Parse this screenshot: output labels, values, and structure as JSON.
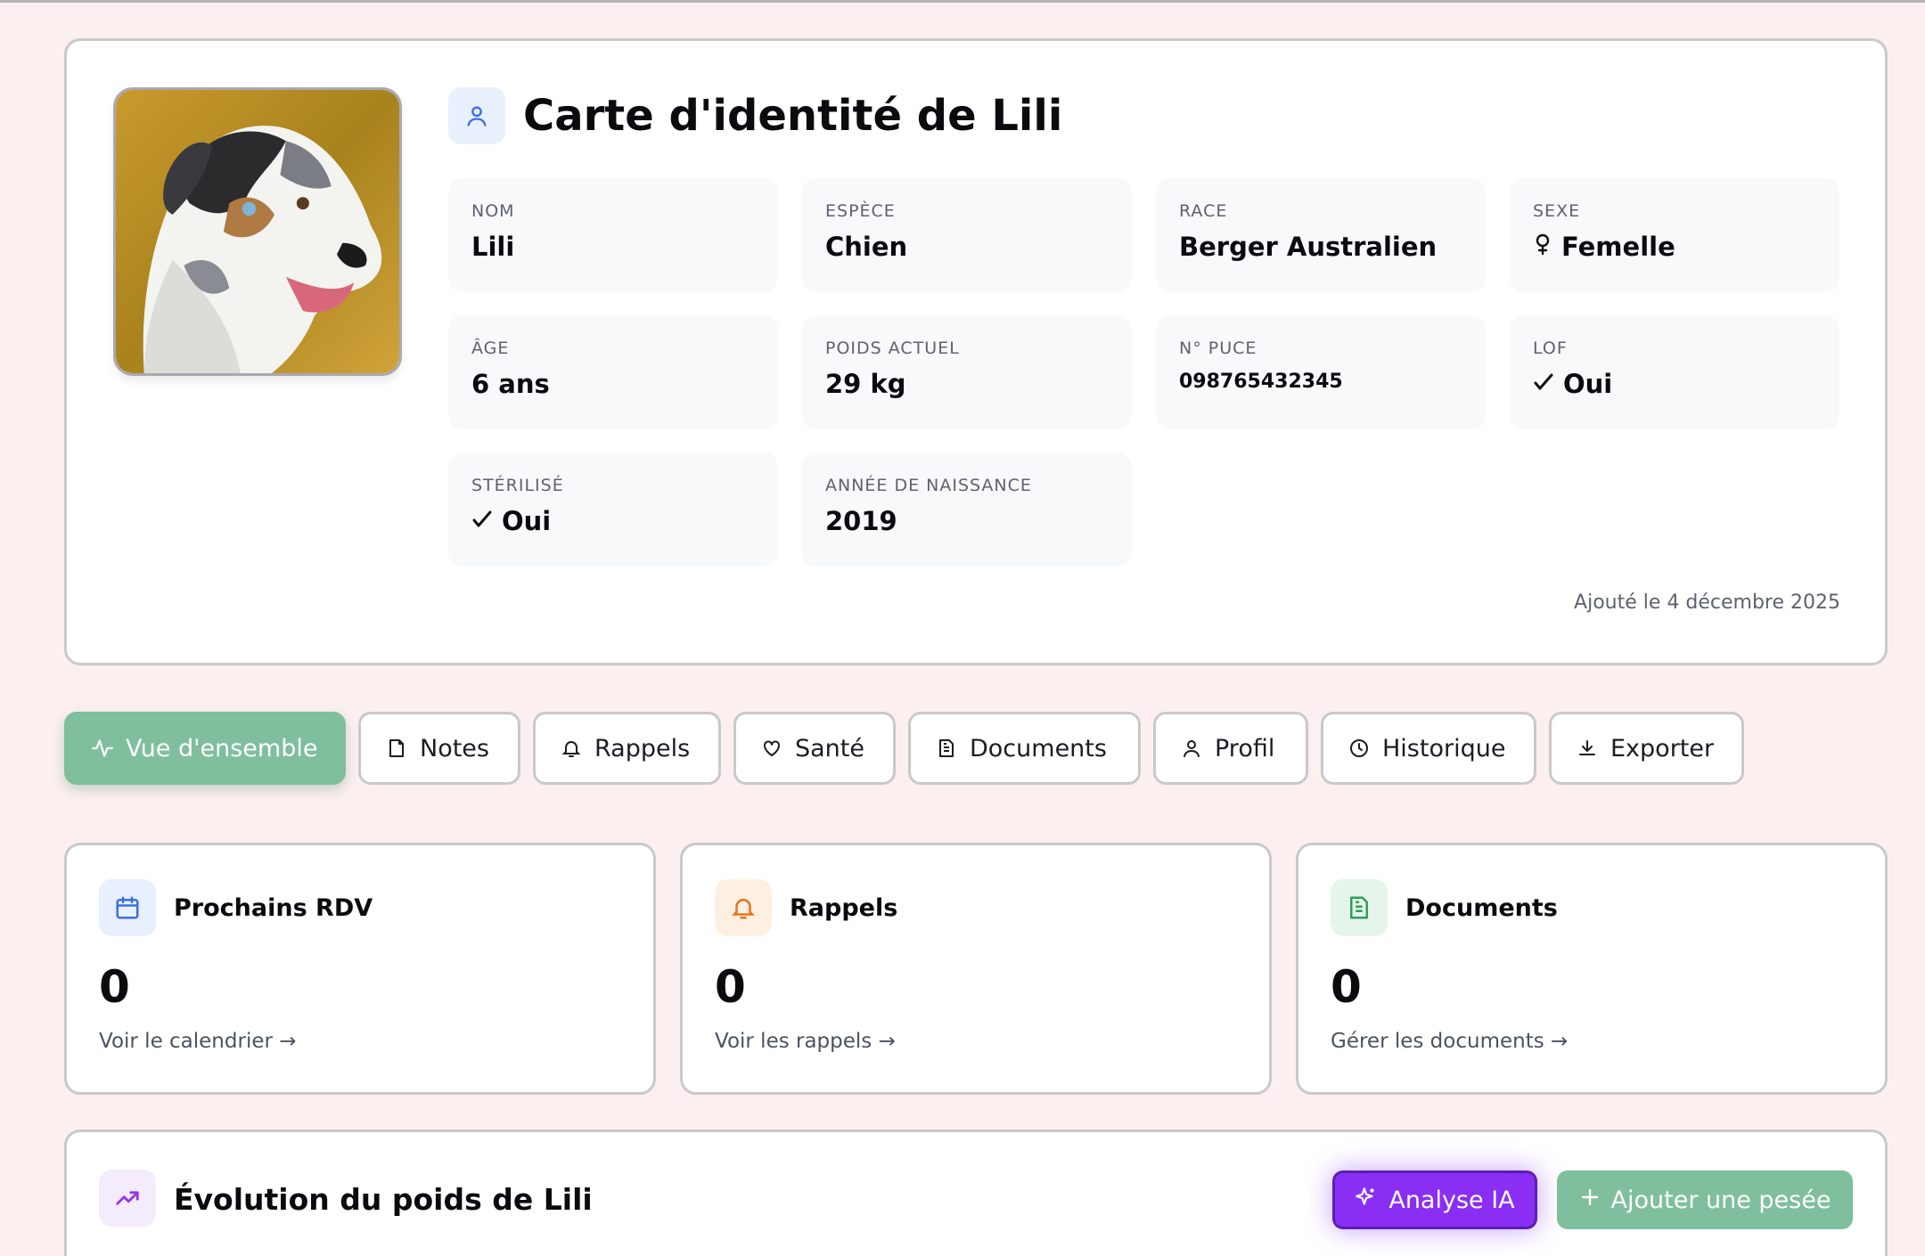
{
  "identity": {
    "title": "Carte d'identité de Lili",
    "fields": [
      {
        "label": "NOM",
        "value": "Lili"
      },
      {
        "label": "ESPÈCE",
        "value": "Chien"
      },
      {
        "label": "RACE",
        "value": "Berger Australien"
      },
      {
        "label": "SEXE",
        "value": "Femelle"
      },
      {
        "label": "ÂGE",
        "value": "6 ans"
      },
      {
        "label": "POIDS ACTUEL",
        "value": "29 kg"
      },
      {
        "label": "N° PUCE",
        "value": "098765432345"
      },
      {
        "label": "LOF",
        "value": "Oui"
      },
      {
        "label": "STÉRILISÉ",
        "value": "Oui"
      },
      {
        "label": "ANNÉE DE NAISSANCE",
        "value": "2019"
      }
    ],
    "added": "Ajouté le 4 décembre 2025"
  },
  "tabs": [
    {
      "label": "Vue d'ensemble",
      "icon": "activity-icon"
    },
    {
      "label": "Notes",
      "icon": "note-icon"
    },
    {
      "label": "Rappels",
      "icon": "bell-icon"
    },
    {
      "label": "Santé",
      "icon": "heart-icon"
    },
    {
      "label": "Documents",
      "icon": "document-icon"
    },
    {
      "label": "Profil",
      "icon": "user-icon"
    },
    {
      "label": "Historique",
      "icon": "clock-icon"
    },
    {
      "label": "Exporter",
      "icon": "download-icon"
    }
  ],
  "stats": [
    {
      "title": "Prochains RDV",
      "count": "0",
      "link": "Voir le calendrier →",
      "icon": "calendar-icon",
      "color": "#3b6fe0"
    },
    {
      "title": "Rappels",
      "count": "0",
      "link": "Voir les rappels →",
      "icon": "bell-icon",
      "color": "#e8731a"
    },
    {
      "title": "Documents",
      "count": "0",
      "link": "Gérer les documents →",
      "icon": "document-icon",
      "color": "#2e9e56"
    }
  ],
  "weight": {
    "title": "Évolution du poids de Lili",
    "ai_button": "Analyse IA",
    "add_button": "Ajouter une pesée"
  },
  "colors": {
    "accent_green": "#7fbf9d",
    "ai_purple": "#8a2ef4",
    "background": "#fbf0ef"
  }
}
